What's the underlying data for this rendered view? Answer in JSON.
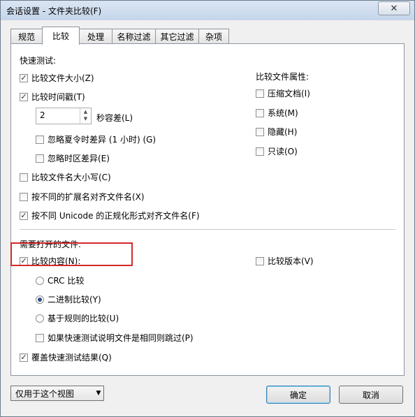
{
  "window": {
    "title": "会话设置 - 文件夹比较(F)",
    "close_glyph": "✕"
  },
  "tabs": [
    {
      "label": "规范",
      "active": false
    },
    {
      "label": "比较",
      "active": true
    },
    {
      "label": "处理",
      "active": false
    },
    {
      "label": "名称过滤",
      "active": false
    },
    {
      "label": "其它过滤",
      "active": false
    },
    {
      "label": "杂项",
      "active": false
    }
  ],
  "quick_test": {
    "heading": "快速测试:",
    "compare_size": {
      "label": "比较文件大小(Z)",
      "checked": true
    },
    "compare_timestamp": {
      "label": "比较时间戳(T)",
      "checked": true
    },
    "seconds_tolerance": {
      "value": "2",
      "label": "秒容差(L)"
    },
    "ignore_dst": {
      "label": "忽略夏令时差异 (1 小时) (G)",
      "checked": false
    },
    "ignore_timezone": {
      "label": "忽略时区差异(E)",
      "checked": false
    },
    "compare_name_case": {
      "label": "比较文件名大小写(C)",
      "checked": false
    },
    "align_by_extension": {
      "label": "按不同的扩展名对齐文件名(X)",
      "checked": false
    },
    "align_unicode": {
      "label": "按不同 Unicode 的正规化形式对齐文件名(F)",
      "checked": true
    }
  },
  "attributes": {
    "heading": "比较文件属性:",
    "items": [
      {
        "label": "压缩文档(I)",
        "checked": false
      },
      {
        "label": "系统(M)",
        "checked": false
      },
      {
        "label": "隐藏(H)",
        "checked": false
      },
      {
        "label": "只读(O)",
        "checked": false
      }
    ]
  },
  "open_files": {
    "heading": "需要打开的文件:",
    "compare_contents": {
      "label": "比较内容(N):",
      "checked": true
    },
    "crc": {
      "label": "CRC 比较",
      "selected": false
    },
    "binary": {
      "label": "二进制比较(Y)",
      "selected": true
    },
    "rules": {
      "label": "基于规则的比较(U)",
      "selected": false
    },
    "skip_if_same": {
      "label": "如果快速测试说明文件是相同则跳过(P)",
      "checked": false
    },
    "compare_versions": {
      "label": "比较版本(V)",
      "checked": false
    },
    "overwrite_results": {
      "label": "覆盖快速测试结果(Q)",
      "checked": true
    }
  },
  "footer": {
    "scope_dropdown": "仅用于这个视图",
    "ok": "确定",
    "cancel": "取消"
  },
  "icons": {
    "checkmark": "✓",
    "spin_up": "▲",
    "spin_down": "▼",
    "dropdown_arrow": "▼"
  },
  "colors": {
    "highlight": "#d22a2a",
    "radio_fill": "#2d4f86"
  }
}
